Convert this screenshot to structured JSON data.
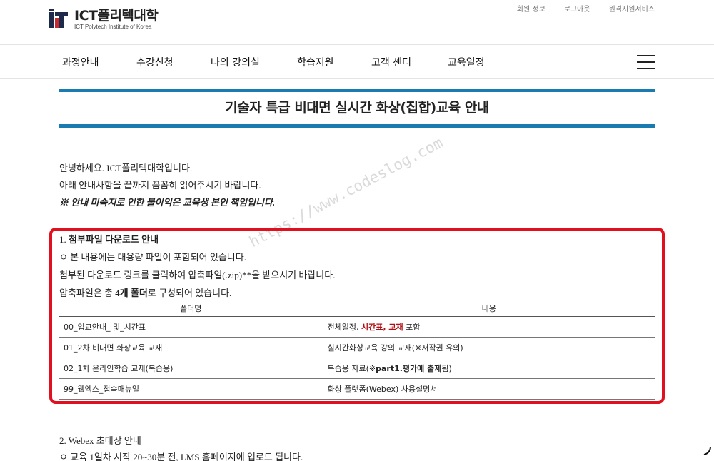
{
  "header": {
    "logo_title": "ICT폴리텍대학",
    "logo_subtitle": "ICT Polytech Institute of Korea",
    "util_links": [
      "회원 정보",
      "로그아웃",
      "원격지원서비스"
    ]
  },
  "nav": {
    "items": [
      "과정안내",
      "수강신청",
      "나의 강의실",
      "학습지원",
      "고객 센터",
      "교육일정"
    ]
  },
  "page": {
    "title": "기술자 특급 비대면 실시간 화상(집합)교육 안내",
    "intro_line1": "안녕하세요. ICT폴리텍대학입니다.",
    "intro_line2": "아래 안내사항을 끝까지 꼼꼼히 읽어주시기 바랍니다.",
    "intro_notice": "※ 안내 미숙지로 인한 불이익은 교육생 본인 책임입니다."
  },
  "section1": {
    "heading_num": "1. ",
    "heading": "첨부파일 다운로드 안내",
    "line1": "ㅇ 본 내용에는 대용량 파일이 포함되어 있습니다.",
    "line2": "첨부된 다운로드 링크를 클릭하여 압축파일(.zip)**을 받으시기 바랍니다.",
    "line3_pre": "압축파일은 총 ",
    "line3_bold": "4개 폴더",
    "line3_post": "로 구성되어 있습니다.",
    "table": {
      "headers": [
        "폴더명",
        "내용"
      ],
      "rows": [
        {
          "folder": "00_입교안내_ 및_시간표",
          "desc_pre": "전체일정, ",
          "desc_red": "시간표, 교재",
          "desc_post": " 포함"
        },
        {
          "folder": "01_2차 비대면 화상교육 교재",
          "desc_pre": "실시간화상교육 강의 교재(※저작권 유의)",
          "desc_red": "",
          "desc_post": ""
        },
        {
          "folder": "02_1차 온라인학습 교재(복습용)",
          "desc_pre": "복습용 자료(※",
          "desc_bold": "part1.평가에 출제",
          "desc_post": "됨)"
        },
        {
          "folder": "99_웹엑스_접속매뉴얼",
          "desc_pre": "화상 플랫폼(Webex) 사용설명서",
          "desc_red": "",
          "desc_post": ""
        }
      ]
    }
  },
  "section2": {
    "heading": "2. Webex 초대장 안내",
    "line1": "ㅇ 교육 1일차 시작 20~30분 전, LMS 홈페이지에 업로드 됩니다."
  },
  "watermark": "https://www.codeslog.com",
  "colors": {
    "accent_blue": "#1a7bb0",
    "highlight_red": "#e0101f",
    "text_red": "#b01015"
  }
}
